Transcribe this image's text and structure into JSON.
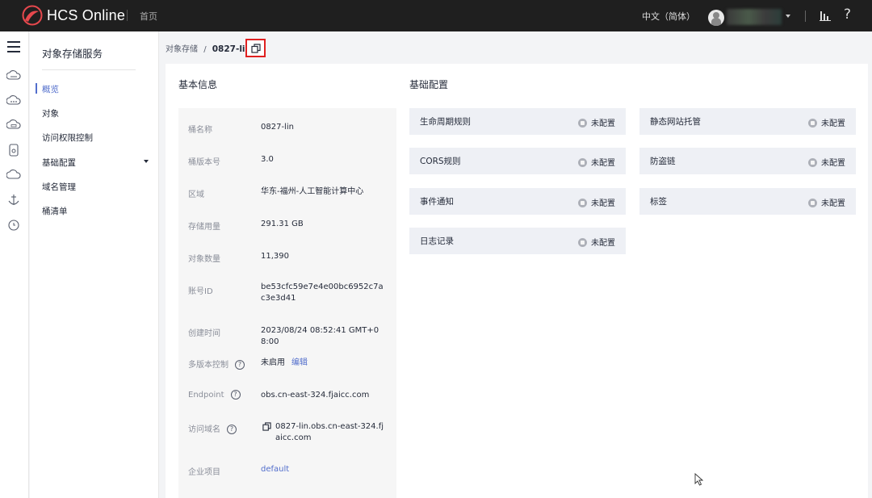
{
  "topbar": {
    "brand": "HCS Online",
    "home": "首页",
    "language": "中文（简体）"
  },
  "sidebar": {
    "title": "对象存储服务",
    "items": [
      {
        "label": "概览",
        "active": true
      },
      {
        "label": "对象"
      },
      {
        "label": "访问权限控制"
      },
      {
        "label": "基础配置",
        "expandable": true
      },
      {
        "label": "域名管理"
      },
      {
        "label": "桶清单"
      }
    ]
  },
  "breadcrumb": {
    "parent": "对象存储",
    "separator": "/",
    "current": "0827-lin"
  },
  "basic_info": {
    "title": "基本信息",
    "rows": [
      {
        "label": "桶名称",
        "value": "0827-lin"
      },
      {
        "label": "桶版本号",
        "value": "3.0"
      },
      {
        "label": "区域",
        "value": "华东-福州-人工智能计算中心"
      },
      {
        "label": "存储用量",
        "value": "291.31 GB"
      },
      {
        "label": "对象数量",
        "value": "11,390"
      },
      {
        "label": "账号ID",
        "value": "be53cfc59e7e4e00bc6952c7ac3e3d41"
      },
      {
        "label": "创建时间",
        "value": "2023/08/24 08:52:41 GMT+08:00"
      },
      {
        "label": "多版本控制",
        "value": "未启用",
        "action": "编辑",
        "help": "?"
      },
      {
        "label": "Endpoint",
        "value": "obs.cn-east-324.fjaicc.com",
        "help": "?"
      },
      {
        "label": "访问域名",
        "value": "0827-lin.obs.cn-east-324.fjaicc.com",
        "help": "?"
      },
      {
        "label": "企业项目",
        "value": "default"
      }
    ]
  },
  "basic_config": {
    "title": "基础配置",
    "items": [
      {
        "name": "生命周期规则",
        "status": "未配置"
      },
      {
        "name": "静态网站托管",
        "status": "未配置"
      },
      {
        "name": "CORS规则",
        "status": "未配置"
      },
      {
        "name": "防盗链",
        "status": "未配置"
      },
      {
        "name": "事件通知",
        "status": "未配置"
      },
      {
        "name": "标签",
        "status": "未配置"
      },
      {
        "name": "日志记录",
        "status": "未配置"
      }
    ]
  },
  "icons": {
    "rail": [
      "menu-icon",
      "cloud-icon",
      "cloud-dots-icon",
      "cloud-ops-icon",
      "storage-box-icon",
      "cloud-sync-icon",
      "anchor-icon",
      "clock-icon"
    ],
    "copy": "copy-icon",
    "help": "question-icon"
  },
  "colors": {
    "topbar": "#1f1f1f",
    "accent": "#526ecc",
    "highlight_border": "#e02020",
    "config_card": "#eef0f5"
  }
}
